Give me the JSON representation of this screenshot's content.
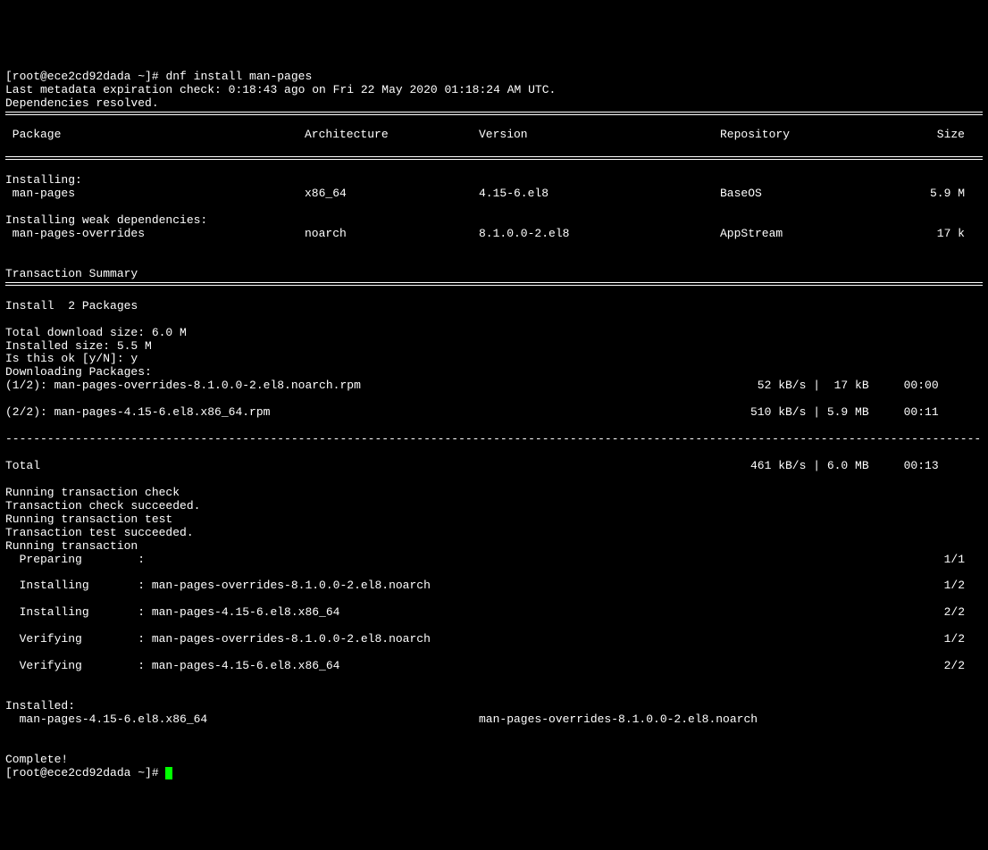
{
  "prompt1": "[root@ece2cd92dada ~]# ",
  "command1": "dnf install man-pages",
  "meta_line": "Last metadata expiration check: 0:18:43 ago on Fri 22 May 2020 01:18:24 AM UTC.",
  "deps_resolved": "Dependencies resolved.",
  "headers": {
    "package": " Package",
    "arch": "Architecture",
    "version": "Version",
    "repo": "Repository",
    "size": "Size"
  },
  "section_installing": "Installing:",
  "pkg1": {
    "name": " man-pages",
    "arch": "x86_64",
    "version": "4.15-6.el8",
    "repo": "BaseOS",
    "size": "5.9 M"
  },
  "section_weak": "Installing weak dependencies:",
  "pkg2": {
    "name": " man-pages-overrides",
    "arch": "noarch",
    "version": "8.1.0.0-2.el8",
    "repo": "AppStream",
    "size": "17 k"
  },
  "txn_summary": "Transaction Summary",
  "install_count": "Install  2 Packages",
  "total_dl": "Total download size: 6.0 M",
  "installed_size": "Installed size: 5.5 M",
  "confirm": "Is this ok [y/N]: y",
  "downloading": "Downloading Packages:",
  "dl1": {
    "left": "(1/2): man-pages-overrides-8.1.0.0-2.el8.noarch.rpm",
    "right": " 52 kB/s |  17 kB     00:00    "
  },
  "dl2": {
    "left": "(2/2): man-pages-4.15-6.el8.x86_64.rpm",
    "right": "510 kB/s | 5.9 MB     00:11    "
  },
  "total": {
    "left": "Total",
    "right": "461 kB/s | 6.0 MB     00:13     "
  },
  "run_check": "Running transaction check",
  "check_ok": "Transaction check succeeded.",
  "run_test": "Running transaction test",
  "test_ok": "Transaction test succeeded.",
  "run_txn": "Running transaction",
  "steps": [
    {
      "left": "  Preparing        :",
      "right": "1/1"
    },
    {
      "left": "  Installing       : man-pages-overrides-8.1.0.0-2.el8.noarch",
      "right": "1/2"
    },
    {
      "left": "  Installing       : man-pages-4.15-6.el8.x86_64",
      "right": "2/2"
    },
    {
      "left": "  Verifying        : man-pages-overrides-8.1.0.0-2.el8.noarch",
      "right": "1/2"
    },
    {
      "left": "  Verifying        : man-pages-4.15-6.el8.x86_64",
      "right": "2/2"
    }
  ],
  "installed_hdr": "Installed:",
  "installed1": "  man-pages-4.15-6.el8.x86_64",
  "installed2": "man-pages-overrides-8.1.0.0-2.el8.noarch",
  "complete": "Complete!",
  "prompt2": "[root@ece2cd92dada ~]# "
}
